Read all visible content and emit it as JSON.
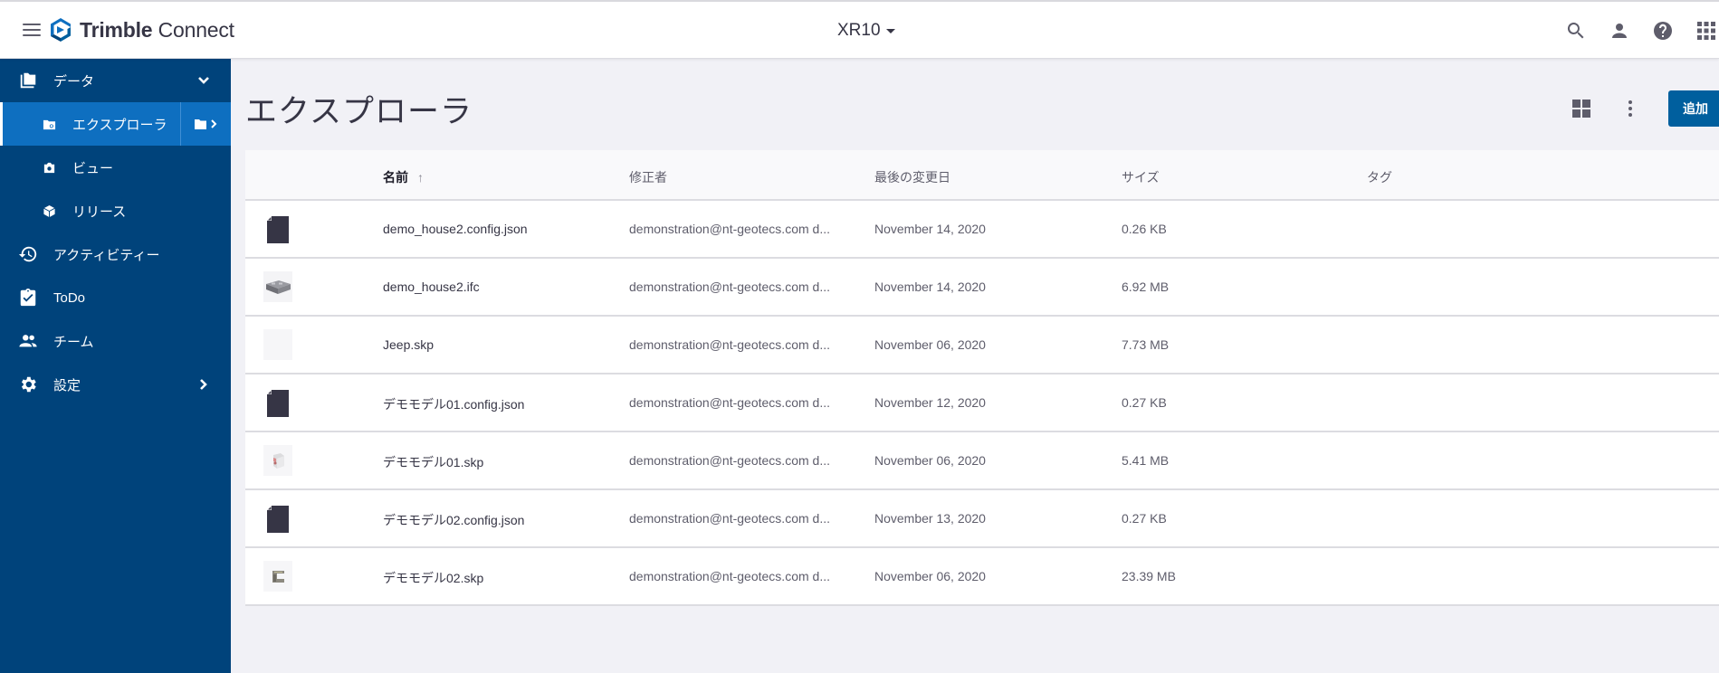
{
  "app": {
    "brand_bold": "Trimble",
    "brand_light": " Connect",
    "project": "XR10"
  },
  "topbar": {
    "icons": [
      "search-icon",
      "user-icon",
      "help-icon",
      "apps-grid-icon"
    ]
  },
  "sidebar": {
    "items": [
      {
        "label": "データ",
        "icon": "folder-icon",
        "expanded": true
      },
      {
        "label": "エクスプローラ",
        "icon": "folder-search-icon",
        "active": true
      },
      {
        "label": "ビュー",
        "icon": "camera-icon"
      },
      {
        "label": "リリース",
        "icon": "package-icon"
      },
      {
        "label": "アクティビティー",
        "icon": "history-icon"
      },
      {
        "label": "ToDo",
        "icon": "clipboard-check-icon"
      },
      {
        "label": "チーム",
        "icon": "group-icon"
      },
      {
        "label": "設定",
        "icon": "gear-icon"
      }
    ]
  },
  "main": {
    "title": "エクスプローラ",
    "add_label": "追加",
    "columns": {
      "name": "名前",
      "sort_indicator": "↑",
      "modified_by": "修正者",
      "last_modified": "最後の変更日",
      "size": "サイズ",
      "tags": "タグ"
    },
    "files": [
      {
        "name": "demo_house2.config.json",
        "modified_by": "demonstration@nt-geotecs.com d...",
        "date": "November 14, 2020",
        "size": "0.26 KB",
        "tags": "",
        "thumb": "document"
      },
      {
        "name": "demo_house2.ifc",
        "modified_by": "demonstration@nt-geotecs.com d...",
        "date": "November 14, 2020",
        "size": "6.92 MB",
        "tags": "",
        "thumb": "model-house"
      },
      {
        "name": "Jeep.skp",
        "modified_by": "demonstration@nt-geotecs.com d...",
        "date": "November 06, 2020",
        "size": "7.73 MB",
        "tags": "",
        "thumb": "blank"
      },
      {
        "name": "デモモデル01.config.json",
        "modified_by": "demonstration@nt-geotecs.com d...",
        "date": "November 12, 2020",
        "size": "0.27 KB",
        "tags": "",
        "thumb": "document"
      },
      {
        "name": "デモモデル01.skp",
        "modified_by": "demonstration@nt-geotecs.com d...",
        "date": "November 06, 2020",
        "size": "5.41 MB",
        "tags": "",
        "thumb": "model-01"
      },
      {
        "name": "デモモデル02.config.json",
        "modified_by": "demonstration@nt-geotecs.com d...",
        "date": "November 13, 2020",
        "size": "0.27 KB",
        "tags": "",
        "thumb": "document"
      },
      {
        "name": "デモモデル02.skp",
        "modified_by": "demonstration@nt-geotecs.com d...",
        "date": "November 06, 2020",
        "size": "23.39 MB",
        "tags": "",
        "thumb": "model-02"
      }
    ]
  },
  "colors": {
    "sidebar_bg": "#00437b",
    "sidebar_active": "#0e6fc0",
    "primary_button": "#005f9e",
    "page_bg": "#f1f1f6"
  }
}
